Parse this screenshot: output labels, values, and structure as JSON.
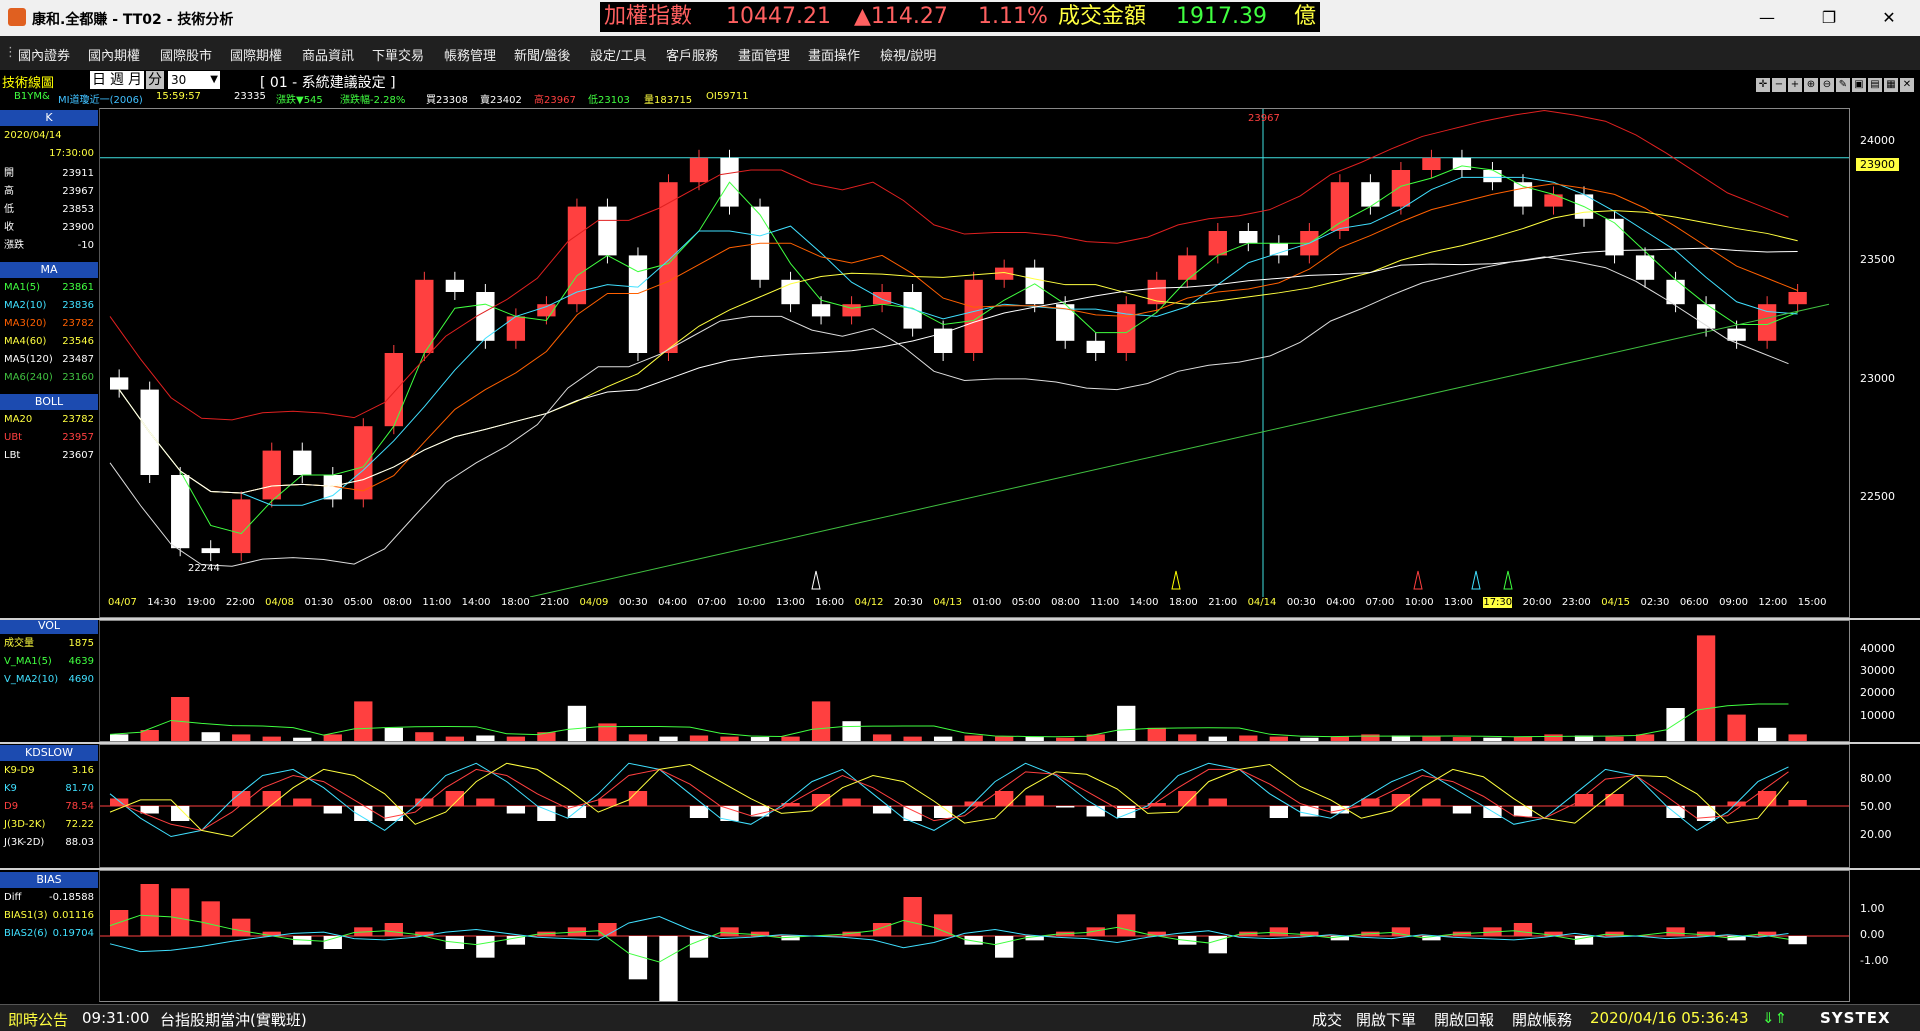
{
  "window": {
    "title": "康和.全都賺 - TT02 - 技術分析"
  },
  "ticker": {
    "index_label": "加權指數",
    "index_value": "10447.21",
    "change": "▲114.27",
    "change_pct": "1.11%",
    "turnover_label": "成交金額",
    "turnover_value": "1917.39",
    "unit": "億"
  },
  "menu": [
    "國內證券",
    "國內期權",
    "國際股市",
    "國際期權",
    "商品資訊",
    "下單交易",
    "帳務管理",
    "新聞/盤後",
    "設定/工具",
    "客戶服務",
    "畫面管理",
    "畫面操作",
    "檢視/說明"
  ],
  "toolbar": {
    "title": "技術線圖",
    "periods": [
      "日",
      "週",
      "月",
      "分"
    ],
    "active_period": "分",
    "count": "30",
    "layout": "[ 01 - 系統建議設定 ]"
  },
  "quote": {
    "symbol": "B1YM&",
    "contract": "MI道瓊近一(2006)",
    "time": "15:59:57",
    "price": "23335",
    "change": "漲跌▼545",
    "change_pct": "漲跌幅-2.28%",
    "bid": "買23308",
    "ask": "賣23402",
    "high": "高23967",
    "low": "低23103",
    "volume": "量183715",
    "oi": "OI59711"
  },
  "side_k": {
    "head": "K",
    "date": "2020/04/14",
    "time": "17:30:00",
    "rows": [
      {
        "k": "開",
        "v": "23911"
      },
      {
        "k": "高",
        "v": "23967"
      },
      {
        "k": "低",
        "v": "23853"
      },
      {
        "k": "收",
        "v": "23900"
      },
      {
        "k": "漲跌",
        "v": "-10"
      }
    ]
  },
  "side_ma": {
    "head": "MA",
    "rows": [
      {
        "k": "MA1(5)",
        "v": "23861"
      },
      {
        "k": "MA2(10)",
        "v": "23836"
      },
      {
        "k": "MA3(20)",
        "v": "23782"
      },
      {
        "k": "MA4(60)",
        "v": "23546"
      },
      {
        "k": "MA5(120)",
        "v": "23487"
      },
      {
        "k": "MA6(240)",
        "v": "23160"
      }
    ]
  },
  "side_boll": {
    "head": "BOLL",
    "rows": [
      {
        "k": "MA20",
        "v": "23782"
      },
      {
        "k": "UBt",
        "v": "23957"
      },
      {
        "k": "LBt",
        "v": "23607"
      }
    ]
  },
  "side_vol": {
    "head": "VOL",
    "rows": [
      {
        "k": "成交量",
        "v": "1875"
      },
      {
        "k": "V_MA1(5)",
        "v": "4639"
      },
      {
        "k": "V_MA2(10)",
        "v": "4690"
      }
    ]
  },
  "side_kd": {
    "head": "KDSLOW",
    "rows": [
      {
        "k": "K9-D9",
        "v": "3.16"
      },
      {
        "k": "K9",
        "v": "81.70"
      },
      {
        "k": "D9",
        "v": "78.54"
      },
      {
        "k": "J(3D-2K)",
        "v": "72.22"
      },
      {
        "k": "J(3K-2D)",
        "v": "88.03"
      }
    ]
  },
  "side_bias": {
    "head": "BIAS",
    "rows": [
      {
        "k": "Diff",
        "v": "-0.18588"
      },
      {
        "k": "BIAS1(3)",
        "v": "0.01116"
      },
      {
        "k": "BIAS2(6)",
        "v": "0.19704"
      }
    ]
  },
  "price_axis": [
    "24000",
    "23500",
    "23000",
    "22500"
  ],
  "price_marker": "23900",
  "high_label": "23967",
  "low_label": "22244",
  "time_axis": [
    "04/07",
    "14:30",
    "19:00",
    "22:00",
    "04/08",
    "01:30",
    "05:00",
    "08:00",
    "11:00",
    "14:00",
    "18:00",
    "21:00",
    "04/09",
    "00:30",
    "04:00",
    "07:00",
    "10:00",
    "13:00",
    "16:00",
    "04/12",
    "20:30",
    "04/13",
    "01:00",
    "05:00",
    "08:00",
    "11:00",
    "14:00",
    "18:00",
    "21:00",
    "04/14",
    "00:30",
    "04:00",
    "07:00",
    "10:00",
    "13:00",
    "17:30",
    "20:00",
    "23:00",
    "04/15",
    "02:30",
    "06:00",
    "09:00",
    "12:00",
    "15:00"
  ],
  "vol_axis": [
    "40000",
    "30000",
    "20000",
    "10000"
  ],
  "kd_axis": [
    "80.00",
    "50.00",
    "20.00"
  ],
  "bias_axis": [
    "1.00",
    "0.00",
    "-1.00"
  ],
  "status": {
    "news_label": "即時公告",
    "news_time": "09:31:00",
    "news_text": "台指股期當沖(實戰班)",
    "buttons": [
      "成交",
      "開啟下單",
      "開啟回報",
      "開啟帳務"
    ],
    "datetime": "2020/04/16 05:36:43",
    "brand": "SYSTEX"
  },
  "colors": {
    "up": "#ff4040",
    "down": "#ffffff",
    "ma1": "#40ff40",
    "ma2": "#40e0ff",
    "ma3": "#ff6000",
    "ma4": "#ffff40",
    "ma5": "#ffffff",
    "ma6": "#40c040",
    "boll": "#e02020",
    "cyan_line": "#40e0e0"
  },
  "chart_data": [
    {
      "type": "candlestick",
      "title": "",
      "ylim": [
        22100,
        24100
      ],
      "series": [
        {
          "name": "close",
          "values": [
            22950,
            22600,
            22300,
            22280,
            22500,
            22700,
            22600,
            22500,
            22800,
            23100,
            23400,
            23350,
            23150,
            23250,
            23300,
            23700,
            23500,
            23100,
            23800,
            23900,
            23700,
            23400,
            23300,
            23250,
            23300,
            23350,
            23200,
            23100,
            23400,
            23450,
            23300,
            23150,
            23100,
            23300,
            23400,
            23500,
            23600,
            23550,
            23500,
            23600,
            23800,
            23700,
            23850,
            23900,
            23850,
            23800,
            23700,
            23750,
            23650,
            23500,
            23400,
            23300,
            23200,
            23150,
            23300,
            23350
          ]
        },
        {
          "name": "MA6(240)",
          "values": [
            22100,
            22250,
            22400,
            22550,
            22700,
            22850,
            23000,
            23150,
            23300
          ]
        }
      ]
    },
    {
      "type": "bar",
      "title": "",
      "ylim": [
        0,
        50000
      ],
      "series": [
        {
          "name": "成交量",
          "values": [
            3000,
            5000,
            20000,
            4000,
            3000,
            2000,
            1500,
            3000,
            18000,
            6000,
            4000,
            2000,
            2500,
            2000,
            4000,
            16000,
            8000,
            3000,
            2000,
            2500,
            2000,
            1800,
            2000,
            18000,
            9000,
            3000,
            2000,
            2000,
            2500,
            2000,
            1800,
            1500,
            3000,
            16000,
            6000,
            3000,
            2000,
            2500,
            2000,
            1500,
            2000,
            3000,
            2500,
            2000,
            1800,
            1500,
            2000,
            3000,
            2500,
            2000,
            3000,
            15000,
            48000,
            12000,
            6000,
            3000
          ]
        }
      ]
    },
    {
      "type": "line",
      "title": "",
      "ylim": [
        0,
        100
      ],
      "series": [
        {
          "name": "K9",
          "values": [
            60,
            40,
            25,
            30,
            55,
            75,
            80,
            65,
            45,
            30,
            50,
            75,
            85,
            70,
            50,
            40,
            60,
            85,
            80,
            60,
            40,
            35,
            50,
            70,
            80,
            60,
            40,
            30,
            45,
            70,
            85,
            75,
            55,
            40,
            50,
            75,
            85,
            80,
            60,
            45,
            40,
            55,
            70,
            80,
            65,
            50,
            35,
            40,
            60,
            80,
            75,
            50,
            30,
            45,
            70,
            82
          ]
        },
        {
          "name": "D9",
          "values": [
            55,
            45,
            35,
            30,
            45,
            65,
            75,
            70,
            55,
            40,
            45,
            65,
            80,
            75,
            60,
            48,
            55,
            75,
            80,
            68,
            50,
            42,
            48,
            62,
            75,
            65,
            50,
            38,
            42,
            60,
            78,
            76,
            62,
            48,
            48,
            65,
            80,
            80,
            68,
            52,
            45,
            50,
            62,
            75,
            70,
            58,
            42,
            40,
            52,
            72,
            75,
            58,
            40,
            42,
            60,
            78
          ]
        }
      ]
    },
    {
      "type": "bar",
      "title": "",
      "ylim": [
        -1.5,
        1.5
      ],
      "series": [
        {
          "name": "Diff",
          "values": [
            0.6,
            1.2,
            1.1,
            0.8,
            0.4,
            0.1,
            -0.2,
            -0.3,
            0.2,
            0.3,
            0.1,
            -0.3,
            -0.5,
            -0.2,
            0.1,
            0.2,
            0.3,
            -1.0,
            -1.5,
            -0.5,
            0.2,
            0.1,
            -0.1,
            0.0,
            0.1,
            0.3,
            0.9,
            0.5,
            -0.2,
            -0.5,
            -0.1,
            0.1,
            0.2,
            0.5,
            0.1,
            -0.2,
            -0.4,
            0.1,
            0.2,
            0.1,
            -0.1,
            0.1,
            0.2,
            -0.1,
            0.1,
            0.2,
            0.3,
            0.1,
            -0.2,
            0.1,
            0.0,
            0.2,
            0.1,
            -0.1,
            0.1,
            -0.19
          ]
        }
      ]
    }
  ]
}
